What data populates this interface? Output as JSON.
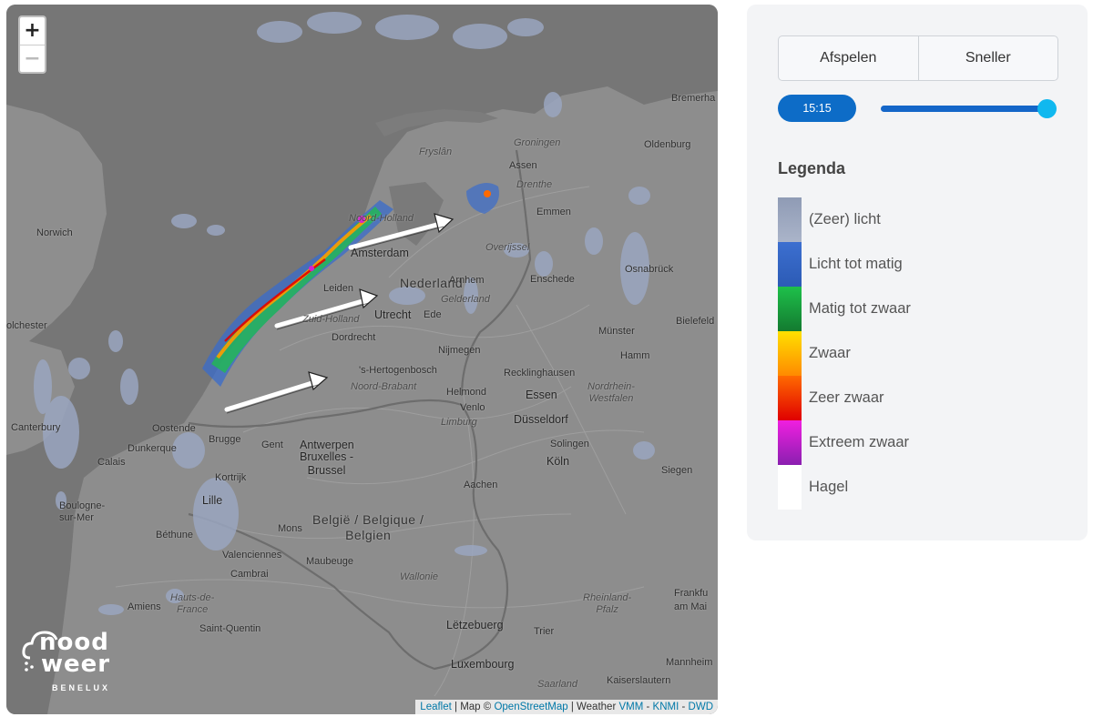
{
  "map": {
    "zoom_in_label": "+",
    "zoom_out_label": "−",
    "attribution": {
      "leaflet": "Leaflet",
      "sep1": " | Map © ",
      "osm": "OpenStreetMap",
      "sep2": " | Weather ",
      "vmm": "VMM",
      "dash1": " - ",
      "knmi": "KNMI",
      "dash2": " - ",
      "dwd": "DWD"
    },
    "logo": {
      "line1": "nood",
      "line2": "weer",
      "line3": "BENELUX"
    },
    "labels": [
      {
        "text": "Norwich"
      },
      {
        "text": "olchester"
      },
      {
        "text": "Canterbury"
      },
      {
        "text": "Calais"
      },
      {
        "text": "Boulogne-\nsur-Mer"
      },
      {
        "text": "Dunkerque"
      },
      {
        "text": "Oostende"
      },
      {
        "text": "Brugge"
      },
      {
        "text": "Gent"
      },
      {
        "text": "Antwerpen"
      },
      {
        "text": "Bruxelles -\nBrussel"
      },
      {
        "text": "Kortrijk"
      },
      {
        "text": "Lille"
      },
      {
        "text": "Béthune"
      },
      {
        "text": "Valenciennes"
      },
      {
        "text": "Mons"
      },
      {
        "text": "Cambrai"
      },
      {
        "text": "Amiens"
      },
      {
        "text": "Hauts-de-\nFrance"
      },
      {
        "text": "Saint-Quentin"
      },
      {
        "text": "Maubeuge"
      },
      {
        "text": "België / Belgique /\nBelgien"
      },
      {
        "text": "Wallonie"
      },
      {
        "text": "Lëtzebuerg"
      },
      {
        "text": "Luxembourg"
      },
      {
        "text": "Trier"
      },
      {
        "text": "Saarland"
      },
      {
        "text": "Kaiserslautern"
      },
      {
        "text": "Mannheim"
      },
      {
        "text": "Frankfu\nam Mai"
      },
      {
        "text": "Rheinland-\nPfalz"
      },
      {
        "text": "Siegen"
      },
      {
        "text": "Köln"
      },
      {
        "text": "Solingen"
      },
      {
        "text": "Düsseldorf"
      },
      {
        "text": "Essen"
      },
      {
        "text": "Nordrhein-\nWestfalen"
      },
      {
        "text": "Recklinghausen"
      },
      {
        "text": "Hamm"
      },
      {
        "text": "Münster"
      },
      {
        "text": "Bielefeld"
      },
      {
        "text": "Osnabrück"
      },
      {
        "text": "Enschede"
      },
      {
        "text": "Overijssel"
      },
      {
        "text": "Emmen"
      },
      {
        "text": "Drenthe"
      },
      {
        "text": "Assen"
      },
      {
        "text": "Groningen"
      },
      {
        "text": "Oldenburg"
      },
      {
        "text": "Bremerha"
      },
      {
        "text": "Fryslân"
      },
      {
        "text": "Noord-Holland"
      },
      {
        "text": "Amsterdam"
      },
      {
        "text": "Nederland"
      },
      {
        "text": "Gelderland"
      },
      {
        "text": "Arnhem"
      },
      {
        "text": "Ede"
      },
      {
        "text": "Utrecht"
      },
      {
        "text": "Leiden"
      },
      {
        "text": "Zuid-Holland"
      },
      {
        "text": "Dordrecht"
      },
      {
        "text": "'s-Hertogenbosch"
      },
      {
        "text": "Noord-Brabant"
      },
      {
        "text": "Nijmegen"
      },
      {
        "text": "Helmond"
      },
      {
        "text": "Venlo"
      },
      {
        "text": "Limburg"
      },
      {
        "text": "Aachen"
      }
    ]
  },
  "controls": {
    "play_label": "Afspelen",
    "faster_label": "Sneller",
    "time": "15:15",
    "slider_value": 1.0
  },
  "legend": {
    "title": "Legenda",
    "items": [
      {
        "label": "(Zeer) licht",
        "color_top": "#8f9bb5",
        "color_bottom": "#aab4c9"
      },
      {
        "label": "Licht tot matig",
        "color_top": "#3c6fd0",
        "color_bottom": "#2c5bb5"
      },
      {
        "label": "Matig tot zwaar",
        "color_top": "#1ec04a",
        "color_bottom": "#137a30"
      },
      {
        "label": "Zwaar",
        "color_top": "#ffe000",
        "color_bottom": "#ff8a00"
      },
      {
        "label": "Zeer zwaar",
        "color_top": "#ff6a00",
        "color_bottom": "#e00000"
      },
      {
        "label": "Extreem zwaar",
        "color_top": "#f01fe0",
        "color_bottom": "#8a1fb0"
      },
      {
        "label": "Hagel",
        "color_top": "#ffffff",
        "color_bottom": "#ffffff"
      }
    ]
  }
}
